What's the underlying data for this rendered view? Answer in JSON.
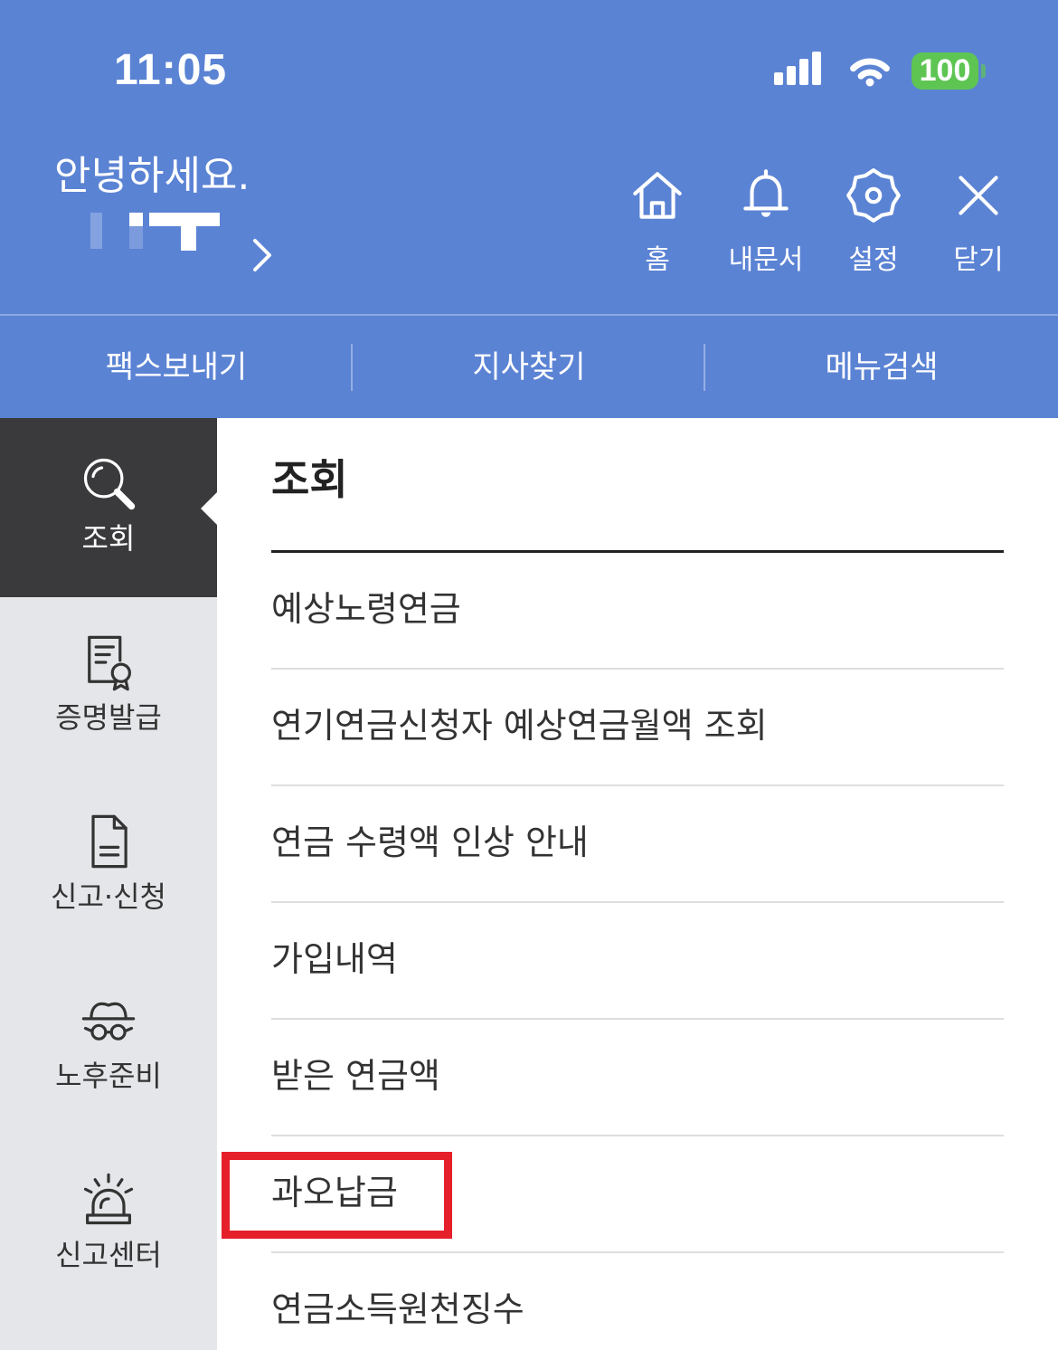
{
  "status_bar": {
    "time": "11:05",
    "battery": "100",
    "icons": [
      "signal-icon",
      "wifi-icon",
      "battery-icon"
    ]
  },
  "header": {
    "greeting": "안녕하세요.",
    "actions": [
      {
        "label": "홈",
        "icon": "home-icon"
      },
      {
        "label": "내문서",
        "icon": "bell-icon"
      },
      {
        "label": "설정",
        "icon": "gear-icon"
      },
      {
        "label": "닫기",
        "icon": "close-icon"
      }
    ]
  },
  "quick_actions": [
    {
      "label": "팩스보내기"
    },
    {
      "label": "지사찾기"
    },
    {
      "label": "메뉴검색"
    }
  ],
  "sidebar": {
    "items": [
      {
        "label": "조회",
        "icon": "search-icon",
        "active": true
      },
      {
        "label": "증명발급",
        "icon": "certificate-icon",
        "active": false
      },
      {
        "label": "신고·신청",
        "icon": "document-icon",
        "active": false
      },
      {
        "label": "노후준비",
        "icon": "hat-glasses-icon",
        "active": false
      },
      {
        "label": "신고센터",
        "icon": "siren-icon",
        "active": false
      }
    ]
  },
  "main": {
    "title": "조회",
    "items": [
      "예상노령연금",
      "연기연금신청자 예상연금월액 조회",
      "연금 수령액 인상 안내",
      "가입내역",
      "받은 연금액",
      "과오납금",
      "연금소득원천징수"
    ]
  },
  "colors": {
    "header_bg": "#5b83d4",
    "active_bg": "#3a3a3c",
    "side_bg": "#e5e6e9",
    "ok_green": "#5ec553",
    "mark_red": "#e5202b",
    "text": "#333333"
  }
}
